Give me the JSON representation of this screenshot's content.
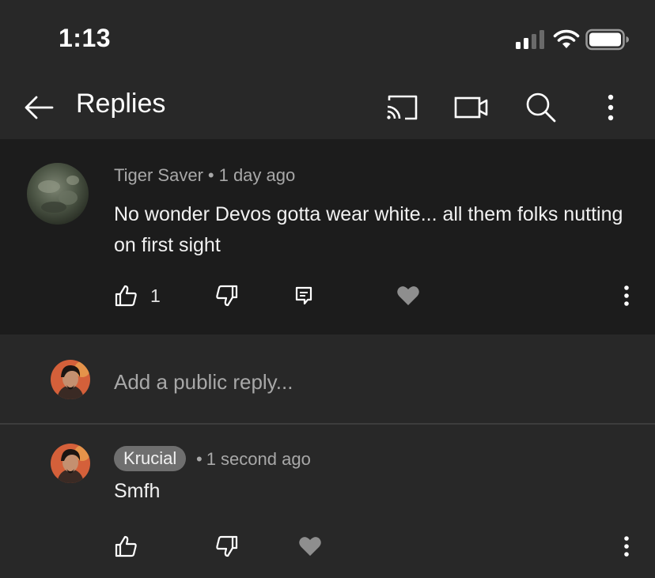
{
  "status_bar": {
    "time": "1:13"
  },
  "header": {
    "title": "Replies"
  },
  "parent_comment": {
    "author": "Tiger Saver",
    "separator": "•",
    "time_ago": "1 day ago",
    "text": "No wonder Devos gotta wear white... all them folks nutting on first sight",
    "like_count": "1"
  },
  "reply_input": {
    "placeholder": "Add a public reply..."
  },
  "reply": {
    "author": "Krucial",
    "separator": "•",
    "time_ago": "1 second ago",
    "text": "Smfh"
  },
  "colors": {
    "background": "#282828",
    "parent_background": "#1c1c1c",
    "secondary_text": "#a8a8a8",
    "badge": "#6f6f6f"
  },
  "icons": [
    "back-arrow-icon",
    "cast-icon",
    "video-camera-icon",
    "search-icon",
    "more-vert-icon",
    "thumbs-up-icon",
    "thumbs-down-icon",
    "reply-icon",
    "heart-icon"
  ]
}
